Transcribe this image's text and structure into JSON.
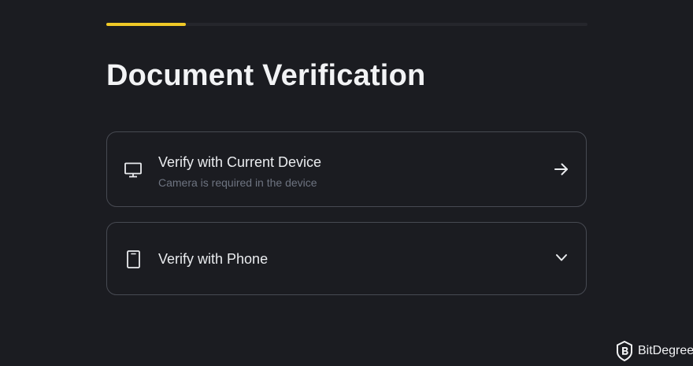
{
  "progress": {
    "value": 0.165,
    "accent": "#f0c927"
  },
  "page": {
    "title": "Document Verification"
  },
  "options": [
    {
      "title": "Verify with Current Device",
      "subtitle": "Camera is required in the device",
      "icon": "monitor-icon",
      "action_icon": "arrow-right-icon"
    },
    {
      "title": "Verify with Phone",
      "icon": "phone-icon",
      "action_icon": "chevron-down-icon"
    }
  ],
  "watermark": {
    "text": "BitDegree",
    "icon": "bitdegree-logo-icon"
  },
  "colors": {
    "background": "#1b1c21",
    "card_border": "#474a52",
    "subtitle": "#6e7481",
    "text": "#eaecef"
  }
}
